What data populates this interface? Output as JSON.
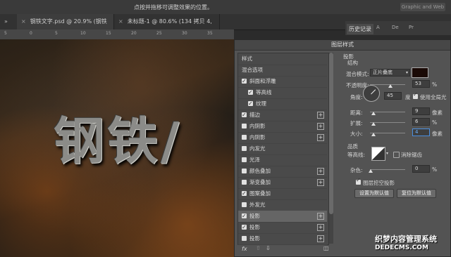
{
  "topbar": {
    "hint": "点按并拖移可调整效果的位置。",
    "workspace": "Graphic and Web"
  },
  "tabs": [
    {
      "label": "»"
    },
    {
      "label": "钢铁文字.psd @ 20.9% (钢铁类, RGB/8)",
      "close": "×"
    },
    {
      "label": "未标题-1 @ 80.6% (134 拷贝 4, RGB/8) *",
      "close": "×"
    }
  ],
  "ruler": [
    "5",
    "0",
    "5",
    "10",
    "15",
    "20",
    "25",
    "30",
    "35"
  ],
  "canvas": {
    "text": "钢铁/"
  },
  "panel": {
    "history_tab": "历史记录",
    "icons": [
      "A",
      "De",
      "Pr"
    ]
  },
  "dialog": {
    "title": "图层样式",
    "styles_header": "样式",
    "blend_options": "混合选项",
    "items": [
      {
        "label": "斜面和浮雕",
        "checked": true,
        "plus": false,
        "indent": false
      },
      {
        "label": "等高线",
        "checked": true,
        "plus": false,
        "indent": true
      },
      {
        "label": "纹理",
        "checked": true,
        "plus": false,
        "indent": true
      },
      {
        "label": "描边",
        "checked": true,
        "plus": true,
        "indent": false
      },
      {
        "label": "内阴影",
        "checked": false,
        "plus": true,
        "indent": false
      },
      {
        "label": "内阴影",
        "checked": false,
        "plus": true,
        "indent": false
      },
      {
        "label": "内发光",
        "checked": false,
        "plus": false,
        "indent": false
      },
      {
        "label": "光泽",
        "checked": false,
        "plus": false,
        "indent": false
      },
      {
        "label": "颜色叠加",
        "checked": false,
        "plus": true,
        "indent": false
      },
      {
        "label": "渐变叠加",
        "checked": false,
        "plus": true,
        "indent": false
      },
      {
        "label": "图案叠加",
        "checked": true,
        "plus": false,
        "indent": false
      },
      {
        "label": "外发光",
        "checked": false,
        "plus": false,
        "indent": false
      },
      {
        "label": "投影",
        "checked": true,
        "plus": true,
        "indent": false,
        "selected": true
      },
      {
        "label": "投影",
        "checked": true,
        "plus": true,
        "indent": false
      },
      {
        "label": "投影",
        "checked": false,
        "plus": true,
        "indent": false
      }
    ],
    "fx": "fx",
    "right": {
      "section": "投影",
      "structure": "结构",
      "blend_mode_label": "混合模式:",
      "blend_mode_value": "正片叠底",
      "opacity_label": "不透明度:",
      "opacity_value": "53",
      "percent": "%",
      "angle_label": "角度:",
      "angle_value": "45",
      "degree": "度",
      "global_light": "使用全局光",
      "distance_label": "距离:",
      "distance_value": "9",
      "px": "像素",
      "spread_label": "扩展:",
      "spread_value": "6",
      "size_label": "大小:",
      "size_value": "4",
      "quality": "品质",
      "contour_label": "等高线:",
      "antialias": "消除锯齿",
      "noise_label": "杂色:",
      "noise_value": "0",
      "knockout": "图层挖空投影",
      "btn_default": "设置为默认值",
      "btn_reset": "复位为默认值"
    }
  },
  "watermark": {
    "line1": "织梦内容管理系统",
    "line2": "DEDECMS.COM"
  }
}
